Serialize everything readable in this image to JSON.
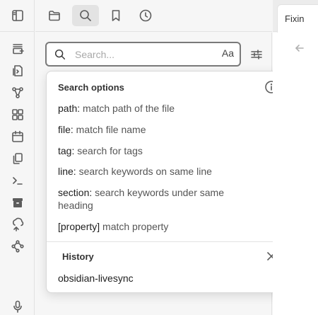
{
  "sidebar_header": {
    "tabs": [
      {
        "name": "files",
        "icon": "folder-icon"
      },
      {
        "name": "search",
        "icon": "search-icon",
        "active": true
      },
      {
        "name": "bookmarks",
        "icon": "bookmark-icon"
      },
      {
        "name": "recent",
        "icon": "clock-icon"
      }
    ]
  },
  "ribbon": {
    "items": [
      "sidebar-toggle-icon",
      "new-canvas-icon",
      "open-quick-switcher-icon",
      "graph-view-icon",
      "templates-icon",
      "daily-note-icon",
      "copy-icon",
      "command-palette-icon",
      "archive-icon",
      "sync-icon",
      "workflow-icon",
      "microphone-icon"
    ]
  },
  "search": {
    "placeholder": "Search...",
    "value": "",
    "case_toggle_label": "Aa"
  },
  "popup": {
    "options_heading": "Search options",
    "options": [
      {
        "key": "path:",
        "desc": " match path of the file"
      },
      {
        "key": "file:",
        "desc": " match file name"
      },
      {
        "key": "tag:",
        "desc": " search for tags"
      },
      {
        "key": "line:",
        "desc": " search keywords on same line"
      },
      {
        "key": "section:",
        "desc": " search keywords under same heading"
      },
      {
        "key": "[property]",
        "desc": " match property"
      }
    ],
    "history_heading": "History",
    "history": [
      "obsidian-livesync"
    ]
  },
  "editor": {
    "tab_title": "Fixin"
  },
  "colors": {
    "background": "#f6f6f6",
    "active_tab": "#e3e3e3",
    "popup_bg": "#ffffff",
    "search_border": "#7a7a7a"
  }
}
